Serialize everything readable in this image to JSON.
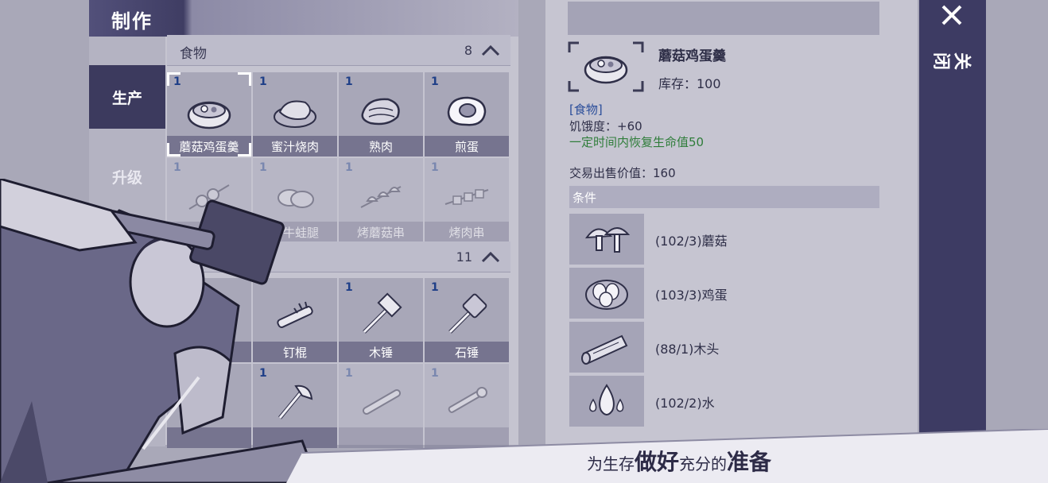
{
  "crafting": {
    "title": "制作",
    "tabs": [
      {
        "label": "生产",
        "active": true
      },
      {
        "label": "升级",
        "active": false
      }
    ],
    "categories": [
      {
        "name": "食物",
        "count": "8",
        "items": [
          {
            "name": "蘑菇鸡蛋羹",
            "qty": "1",
            "icon": "mushroom-egg-custard-icon",
            "dim": false,
            "selected": true
          },
          {
            "name": "蜜汁烧肉",
            "qty": "1",
            "icon": "honey-roast-meat-icon",
            "dim": false
          },
          {
            "name": "熟肉",
            "qty": "1",
            "icon": "cooked-meat-icon",
            "dim": false
          },
          {
            "name": "煎蛋",
            "qty": "1",
            "icon": "fried-egg-icon",
            "dim": false
          },
          {
            "name": "",
            "qty": "1",
            "icon": "meat-skewer-icon",
            "dim": true
          },
          {
            "name": "十牛蛙腿",
            "qty": "1",
            "icon": "frog-legs-icon",
            "dim": true
          },
          {
            "name": "烤蘑菇串",
            "qty": "1",
            "icon": "mushroom-skewer-icon",
            "dim": true
          },
          {
            "name": "烤肉串",
            "qty": "1",
            "icon": "kebab-icon",
            "dim": true
          }
        ]
      },
      {
        "name": "",
        "count": "11",
        "items": [
          {
            "name": "",
            "qty": "",
            "icon": "tool-icon",
            "dim": false
          },
          {
            "name": "钉棍",
            "qty": "",
            "icon": "nail-club-icon",
            "dim": false
          },
          {
            "name": "木锤",
            "qty": "1",
            "icon": "wood-hammer-icon",
            "dim": false
          },
          {
            "name": "石锤",
            "qty": "1",
            "icon": "stone-hammer-icon",
            "dim": false
          },
          {
            "name": "",
            "qty": "",
            "icon": "tool-icon",
            "dim": false
          },
          {
            "name": "",
            "qty": "1",
            "icon": "axe-icon",
            "dim": false
          },
          {
            "name": "",
            "qty": "1",
            "icon": "baton-icon",
            "dim": true
          },
          {
            "name": "",
            "qty": "1",
            "icon": "wrench-icon",
            "dim": true
          }
        ]
      }
    ]
  },
  "detail": {
    "name": "蘑菇鸡蛋羹",
    "stock": "库存：100",
    "category": "[食物]",
    "hunger": "饥饿度：+60",
    "effect": "一定时间内恢复生命值50",
    "price": "交易出售价值：160",
    "conditions_title": "条件",
    "requirements": [
      {
        "text": "(102/3)蘑菇",
        "icon": "mushroom-icon"
      },
      {
        "text": "(103/3)鸡蛋",
        "icon": "eggs-icon"
      },
      {
        "text": "(88/1)木头",
        "icon": "wood-icon"
      },
      {
        "text": "(102/2)水",
        "icon": "water-icon"
      }
    ]
  },
  "close_label": "关闭",
  "tagline": {
    "p1": "为生存",
    "p2": "做好",
    "p3": "充分的",
    "p4": "准备"
  },
  "colors": {
    "accent": "#3c3a5e",
    "qty": "#1f3f88",
    "effect": "#2f7d3a",
    "category": "#2a4d9a"
  }
}
